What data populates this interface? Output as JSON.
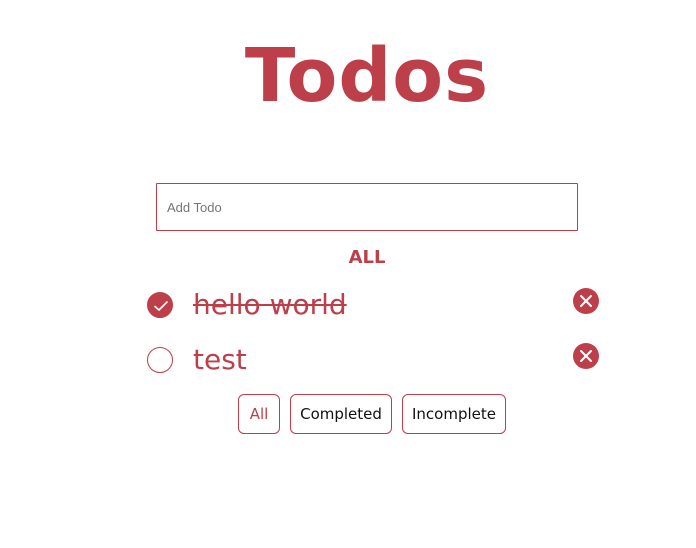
{
  "app": {
    "title": "Todos"
  },
  "add_todo": {
    "placeholder": "Add Todo",
    "value": ""
  },
  "filter": {
    "current_label": "ALL"
  },
  "todos": [
    {
      "text": "hello world",
      "completed": true
    },
    {
      "text": "test",
      "completed": false
    }
  ],
  "filter_buttons": [
    {
      "label": "All",
      "active": true
    },
    {
      "label": "Completed",
      "active": false
    },
    {
      "label": "Incomplete",
      "active": false
    }
  ],
  "colors": {
    "accent": "#bc3f4a",
    "background": "#ffffff"
  },
  "icons": {
    "complete": "checkmark-icon",
    "remove": "close-icon"
  }
}
